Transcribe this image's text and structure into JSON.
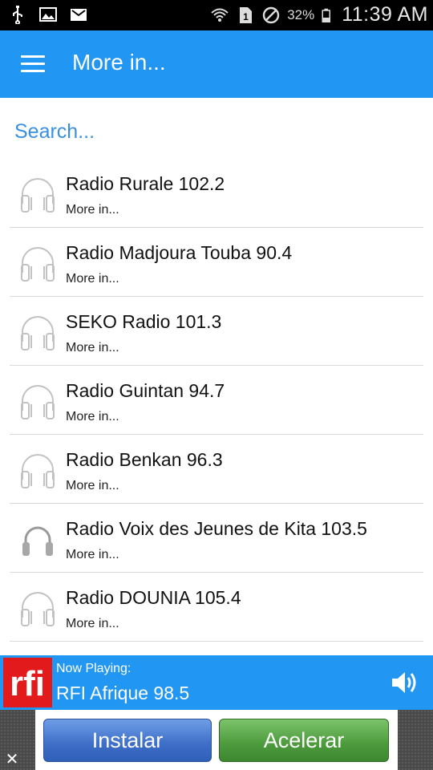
{
  "status_bar": {
    "battery": "32%",
    "time": "11:39 AM",
    "icons": [
      "usb-icon",
      "image-icon",
      "gmail-icon",
      "wifi-icon",
      "sim-icon",
      "blocked-icon",
      "battery-icon"
    ]
  },
  "app_bar": {
    "title": "More in..."
  },
  "search": {
    "placeholder": "Search..."
  },
  "stations": [
    {
      "name": "Radio Rurale 102.2",
      "subtitle": "More in..."
    },
    {
      "name": "Radio Madjoura Touba 90.4",
      "subtitle": "More in..."
    },
    {
      "name": "SEKO Radio 101.3",
      "subtitle": "More in..."
    },
    {
      "name": "Radio Guintan 94.7",
      "subtitle": "More in..."
    },
    {
      "name": "Radio Benkan 96.3",
      "subtitle": "More in..."
    },
    {
      "name": "Radio Voix des Jeunes de Kita 103.5",
      "subtitle": "More in..."
    },
    {
      "name": "Radio DOUNIA 105.4",
      "subtitle": "More in..."
    }
  ],
  "now_playing": {
    "label": "Now Playing:",
    "station": "RFI Afrique 98.5",
    "logo_text": "rfi"
  },
  "ad": {
    "install": "Instalar",
    "speed": "Acelerar",
    "close": "✕"
  },
  "colors": {
    "primary": "#2196f3",
    "link": "#3a8fe0",
    "rfi_red": "#e31a1c"
  }
}
